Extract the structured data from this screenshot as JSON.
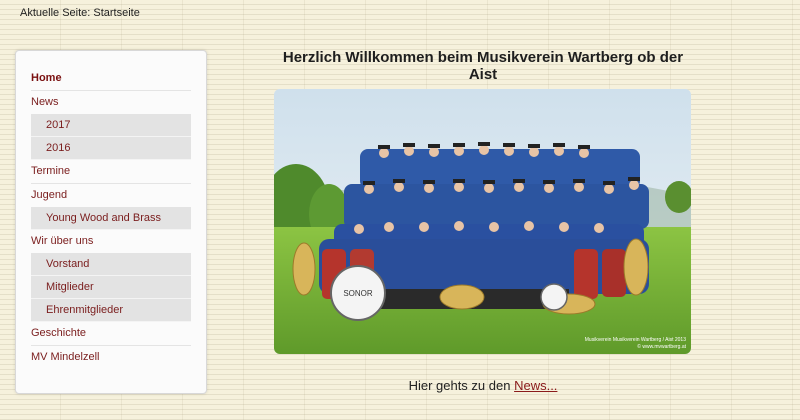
{
  "breadcrumb": "Aktuelle Seite: Startseite",
  "nav": {
    "home": "Home",
    "news": "News",
    "news_2017": "2017",
    "news_2016": "2016",
    "termine": "Termine",
    "jugend": "Jugend",
    "young_wood": "Young Wood and Brass",
    "wir": "Wir über uns",
    "vorstand": "Vorstand",
    "mitglieder": "Mitglieder",
    "ehren": "Ehrenmitglieder",
    "geschichte": "Geschichte",
    "mv": "MV Mindelzell"
  },
  "main": {
    "heading": "Herzlich Willkommen beim Musikverein Wartberg ob der Aist",
    "photo_caption_1": "Musikverein Musikverein Wartberg / Aist 2013",
    "photo_caption_2": "© www.mvwartberg.at",
    "drum_text": "SONOR",
    "footer_text": "Hier gehts zu den ",
    "footer_link": "News..."
  },
  "colors": {
    "link": "#7a1d1d",
    "background": "#f6f1dc"
  }
}
